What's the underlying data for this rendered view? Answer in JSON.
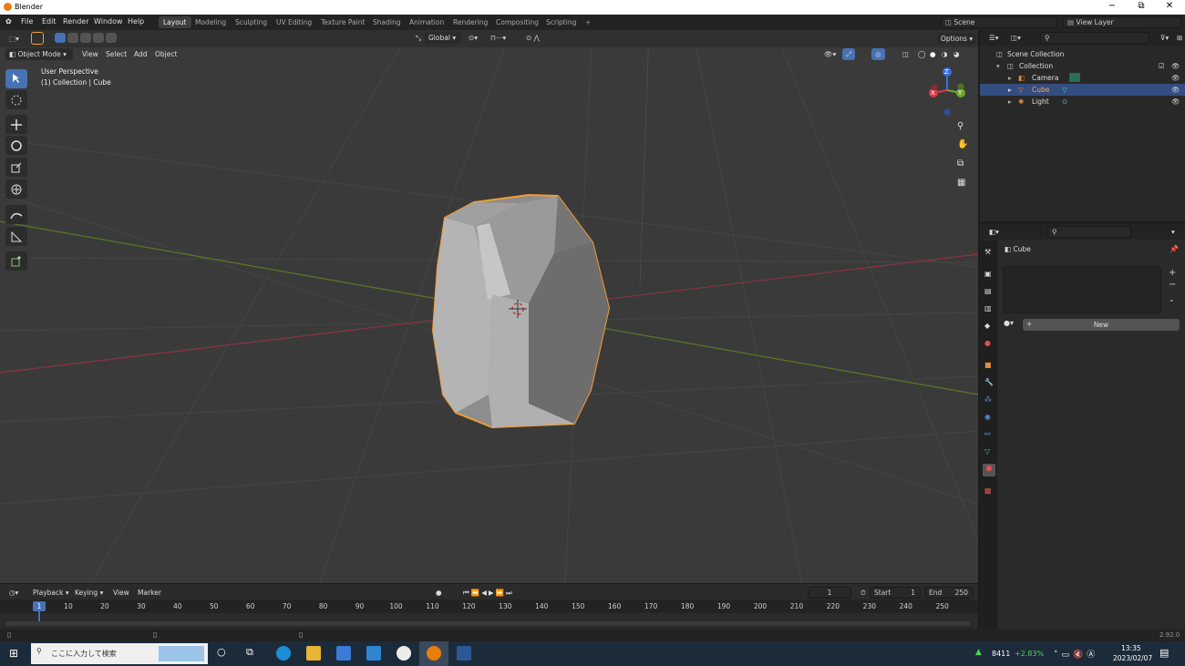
{
  "window": {
    "title": "Blender",
    "min": "−",
    "max": "⧉",
    "close": "✕"
  },
  "menu": [
    "File",
    "Edit",
    "Render",
    "Window",
    "Help"
  ],
  "workspaces": [
    "Layout",
    "Modeling",
    "Sculpting",
    "UV Editing",
    "Texture Paint",
    "Shading",
    "Animation",
    "Rendering",
    "Compositing",
    "Scripting"
  ],
  "active_workspace": "Layout",
  "scene": "Scene",
  "view_layer": "View Layer",
  "tool_header": {
    "orientation": "Global",
    "options": "Options"
  },
  "viewport": {
    "mode": "Object Mode",
    "menus": [
      "View",
      "Select",
      "Add",
      "Object"
    ],
    "perspective": "User Perspective",
    "collection_info": "(1) Collection | Cube",
    "gizmo": {
      "x": "X",
      "y": "Y",
      "z": "Z"
    }
  },
  "outliner": {
    "root": "Scene Collection",
    "collection": "Collection",
    "items": [
      {
        "name": "Camera",
        "color": "#e58a3c"
      },
      {
        "name": "Cube",
        "color": "#e58a3c"
      },
      {
        "name": "Light",
        "color": "#e58a3c"
      }
    ],
    "selected": "Cube"
  },
  "properties": {
    "object": "Cube",
    "new_button": "New"
  },
  "timeline": {
    "menus": [
      "Playback",
      "Keying",
      "View",
      "Marker"
    ],
    "current_frame": "1",
    "start_label": "Start",
    "start": "1",
    "end_label": "End",
    "end": "250",
    "ticks": [
      "1",
      "10",
      "20",
      "30",
      "40",
      "50",
      "60",
      "70",
      "80",
      "90",
      "100",
      "110",
      "120",
      "130",
      "140",
      "150",
      "160",
      "170",
      "180",
      "190",
      "200",
      "210",
      "220",
      "230",
      "240",
      "250"
    ]
  },
  "status": {
    "version": "2.92.0"
  },
  "taskbar": {
    "search_placeholder": "ここに入力して検索",
    "stock_value": "8411",
    "stock_change": "+2.83%",
    "time": "13:35",
    "date": "2023/02/07"
  },
  "colors": {
    "accent": "#4772b3",
    "selection": "#f39c33",
    "x_axis": "#b33c48",
    "y_axis": "#6a8a2a"
  }
}
